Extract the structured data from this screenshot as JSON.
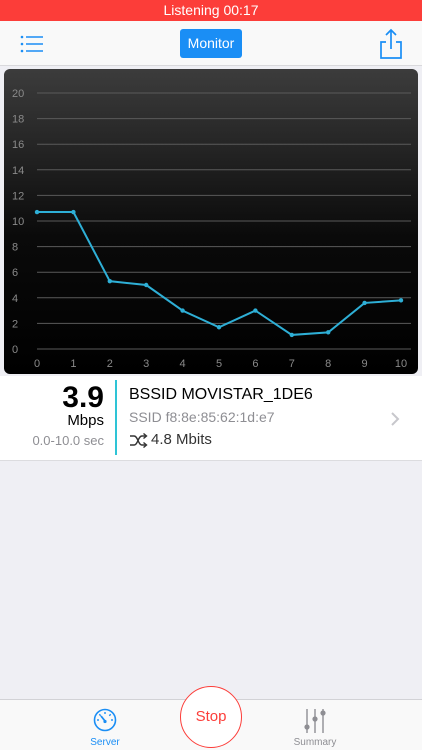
{
  "status_bar": {
    "text": "Listening 00:17"
  },
  "nav": {
    "monitor_label": "Monitor"
  },
  "chart_data": {
    "type": "line",
    "x": [
      0,
      1,
      2,
      3,
      4,
      5,
      6,
      7,
      8,
      9,
      10
    ],
    "series": [
      {
        "values": [
          10.7,
          10.7,
          5.3,
          5.0,
          3.0,
          1.7,
          3.0,
          1.1,
          1.3,
          3.6,
          3.8
        ]
      }
    ],
    "x_ticks": [
      "0",
      "1",
      "2",
      "3",
      "4",
      "5",
      "6",
      "7",
      "8",
      "9",
      "10"
    ],
    "y_ticks": [
      "0",
      "2",
      "4",
      "6",
      "8",
      "10",
      "12",
      "14",
      "16",
      "18",
      "20"
    ],
    "xlim": [
      0,
      10
    ],
    "ylim": [
      0,
      20
    ],
    "grid": true,
    "line_color": "#2eafd6"
  },
  "summary_card": {
    "speed_value": "3.9",
    "speed_unit": "Mbps",
    "time_range": "0.0-10.0 sec",
    "bssid": "BSSID MOVISTAR_1DE6",
    "ssid": "SSID f8:8e:85:62:1d:e7",
    "mbits": "4.8 Mbits"
  },
  "tabs": {
    "server_label": "Server",
    "stop_label": "Stop",
    "summary_label": "Summary"
  },
  "colors": {
    "accent": "#1a8ef5",
    "status": "#fc3d39",
    "divider": "#2ec4d6"
  }
}
